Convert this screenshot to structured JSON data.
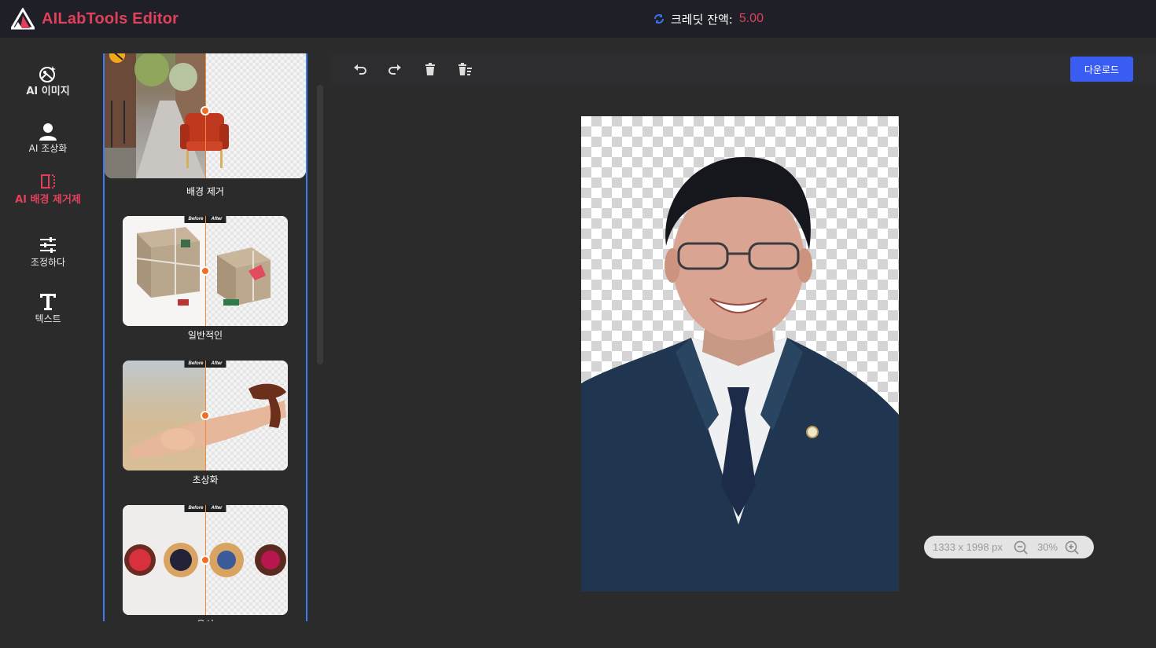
{
  "app": {
    "title": "AILabTools Editor"
  },
  "credit": {
    "label": "크레딧 잔액:",
    "value": "5.00"
  },
  "nav": [
    {
      "label": "AI 이미지",
      "icon": "ai-image-icon"
    },
    {
      "label": "AI 조상화",
      "icon": "portrait-icon"
    },
    {
      "label": "AI 배경 제거제",
      "icon": "background-remove-icon"
    },
    {
      "label": "조정하다",
      "icon": "adjust-sliders-icon"
    },
    {
      "label": "텍스트",
      "icon": "text-icon"
    }
  ],
  "templates": [
    {
      "label": "배경 제거"
    },
    {
      "label": "일반적인",
      "before": "Before",
      "after": "After"
    },
    {
      "label": "초상화",
      "before": "Before",
      "after": "After"
    },
    {
      "label": "음식",
      "before": "Before",
      "after": "After"
    }
  ],
  "toolbar": {
    "download_label": "다운로드",
    "icons": [
      "undo-icon",
      "redo-icon",
      "delete-icon",
      "clear-all-icon"
    ]
  },
  "zoom": {
    "dimensions": "1333 x 1998 px",
    "level": "30%"
  },
  "colors": {
    "brand": "#e0405b",
    "accent": "#3a5cf2",
    "panel_border": "#3d7bf0"
  }
}
